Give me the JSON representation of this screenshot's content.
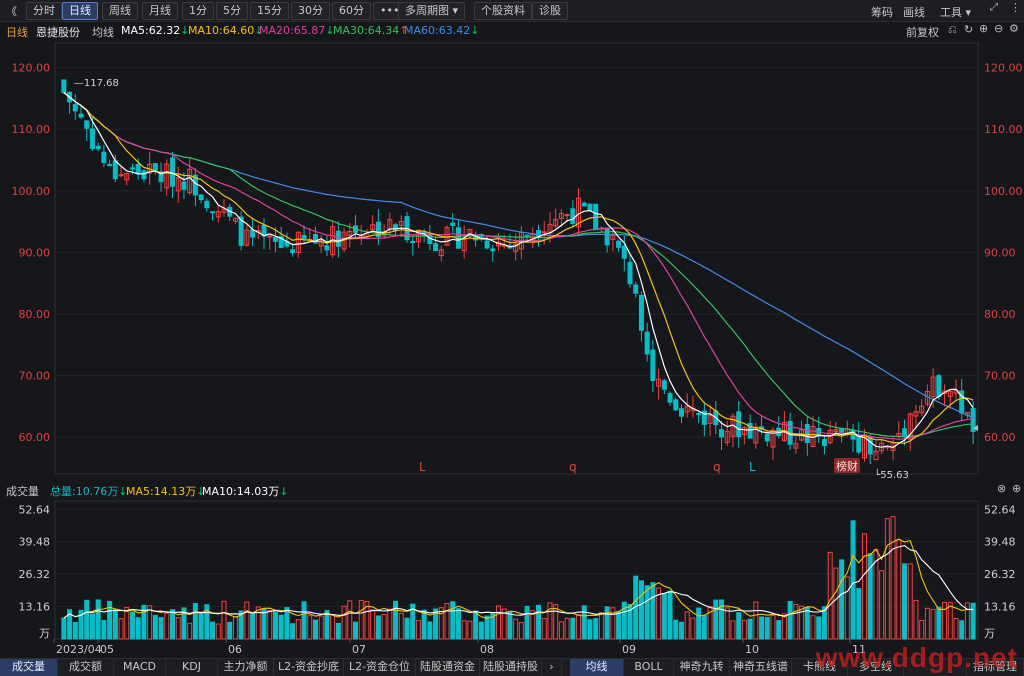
{
  "toolbar": {
    "back": "《",
    "buttons": [
      "分时",
      "日线",
      "周线",
      "月线",
      "1分",
      "5分",
      "15分",
      "30分",
      "60分",
      "•••",
      "多周期图 ▾",
      "个股资料",
      "诊股"
    ],
    "active": "日线",
    "right": [
      "筹码",
      "画线",
      "工具 ▾"
    ]
  },
  "info": {
    "period": "日线",
    "name": "恩捷股份",
    "ma_label": "均线",
    "ma5": "MA5:62.32",
    "ma10": "MA10:64.60",
    "ma20": "MA20:65.87",
    "ma30": "MA30:64.34",
    "ma60": "MA60:63.42",
    "fq": "前复权"
  },
  "colors": {
    "up": "#ff3d3d",
    "down": "#00bfc8",
    "ma5": "#ffffff",
    "ma10": "#f5c400",
    "ma20": "#e040a0",
    "ma30": "#36c060",
    "ma60": "#3f8de6",
    "accent": "#5a79c6"
  },
  "price_axis": {
    "ticks": [
      "120.00",
      "110.00",
      "100.00",
      "90.00",
      "80.00",
      "70.00",
      "60.00"
    ]
  },
  "annotations": {
    "high": "117.68",
    "low": "55.63",
    "markers": [
      "L",
      "q",
      "q",
      "L"
    ],
    "badge": "榜财"
  },
  "volume": {
    "title": "成交量",
    "total": "总量:10.76万",
    "ma5": "MA5:14.13万",
    "ma10": "MA10:14.03万",
    "ticks": [
      "52.64",
      "39.48",
      "26.32",
      "13.16",
      "万"
    ]
  },
  "x_axis": [
    "2023/04",
    "05",
    "06",
    "07",
    "08",
    "09",
    "10",
    "11"
  ],
  "bottom_tabs_left": [
    "成交量",
    "成交额",
    "MACD",
    "KDJ",
    "主力净额",
    "L2-资金抄底",
    "L2-资金仓位",
    "陆股通资金",
    "陆股通持股"
  ],
  "bottom_tabs_right": [
    "均线",
    "BOLL",
    "神奇九转",
    "神奇五线谱",
    "卡熊线",
    "多空线"
  ],
  "bottom_right": "指标管理",
  "watermark": "www.ddgp.net",
  "chart_data": {
    "type": "candlestick",
    "price_range": [
      54,
      124
    ],
    "volume_range": [
      0,
      56
    ],
    "ohlc": [],
    "volume": []
  }
}
